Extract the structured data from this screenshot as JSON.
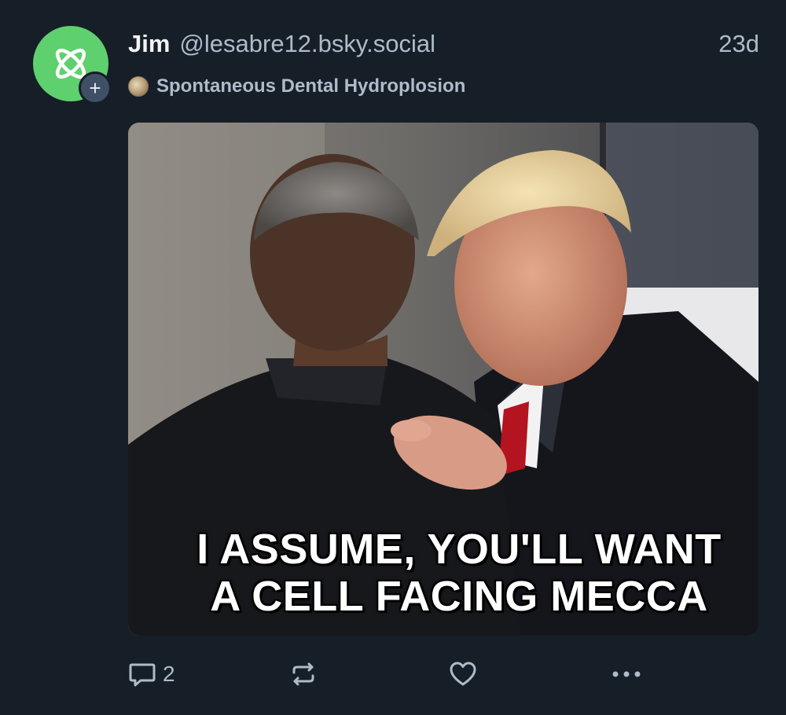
{
  "author": {
    "display_name": "Jim",
    "handle": "@lesabre12.bsky.social",
    "avatar_icon": "atom-icon",
    "avatar_color": "#5fd06e",
    "follow_icon": "plus-icon"
  },
  "post": {
    "timestamp": "23d",
    "feed_name": "Spontaneous Dental Hydroplosion",
    "image": {
      "caption_line1": "I ASSUME, YOU'LL WANT",
      "caption_line2": "A CELL FACING MECCA"
    }
  },
  "actions": {
    "reply_icon": "speech-bubble-icon",
    "reply_count": "2",
    "repost_icon": "repost-icon",
    "like_icon": "heart-icon",
    "more_icon": "ellipsis-icon"
  },
  "colors": {
    "background": "#161e27",
    "secondary_text": "#aebbc9",
    "primary_text": "#f1f3f5"
  }
}
